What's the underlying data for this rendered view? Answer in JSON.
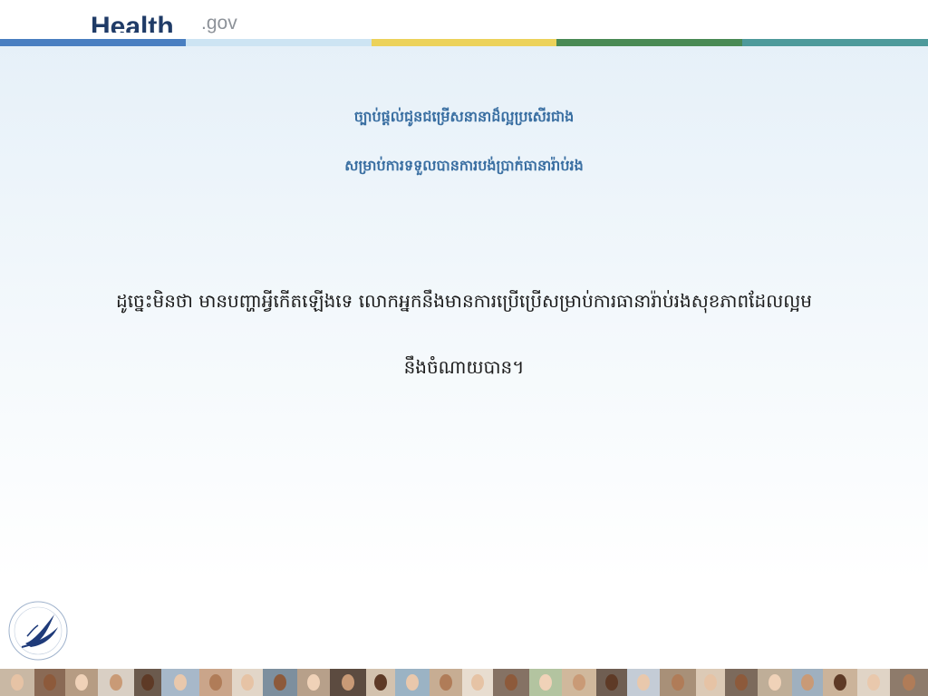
{
  "header": {
    "brand": "Health",
    "tld": ".gov"
  },
  "stripes": [
    "#4a7fc1",
    "#cde4f3",
    "#ecd25b",
    "#4a8a55",
    "#4e9a9b"
  ],
  "slide": {
    "subtitle_line1": "ច្បាប់ផ្តល់ជូនជម្រើសនានាដ៏ល្អប្រសើរជាង",
    "subtitle_line2": "សម្រាប់ការទទួលបានការបង់ប្រាក់ធានារ៉ាប់រង",
    "body_line1": "ដូច្នេះមិនថា មានបញ្ហាអ្វីកើតឡើងទេ លោកអ្នកនឹងមានការប្រើប្រើសម្រាប់ការធានារ៉ាប់រងសុខភាពដែលល្អម",
    "body_line2": "នឹងចំណាយបាន។"
  },
  "colors": {
    "subtitle": "#3a6fa2",
    "body": "#1b1b1b",
    "brand": "#1f3b67",
    "tld": "#8d9299"
  },
  "icons": {
    "seal": "hhs-seal-icon"
  }
}
